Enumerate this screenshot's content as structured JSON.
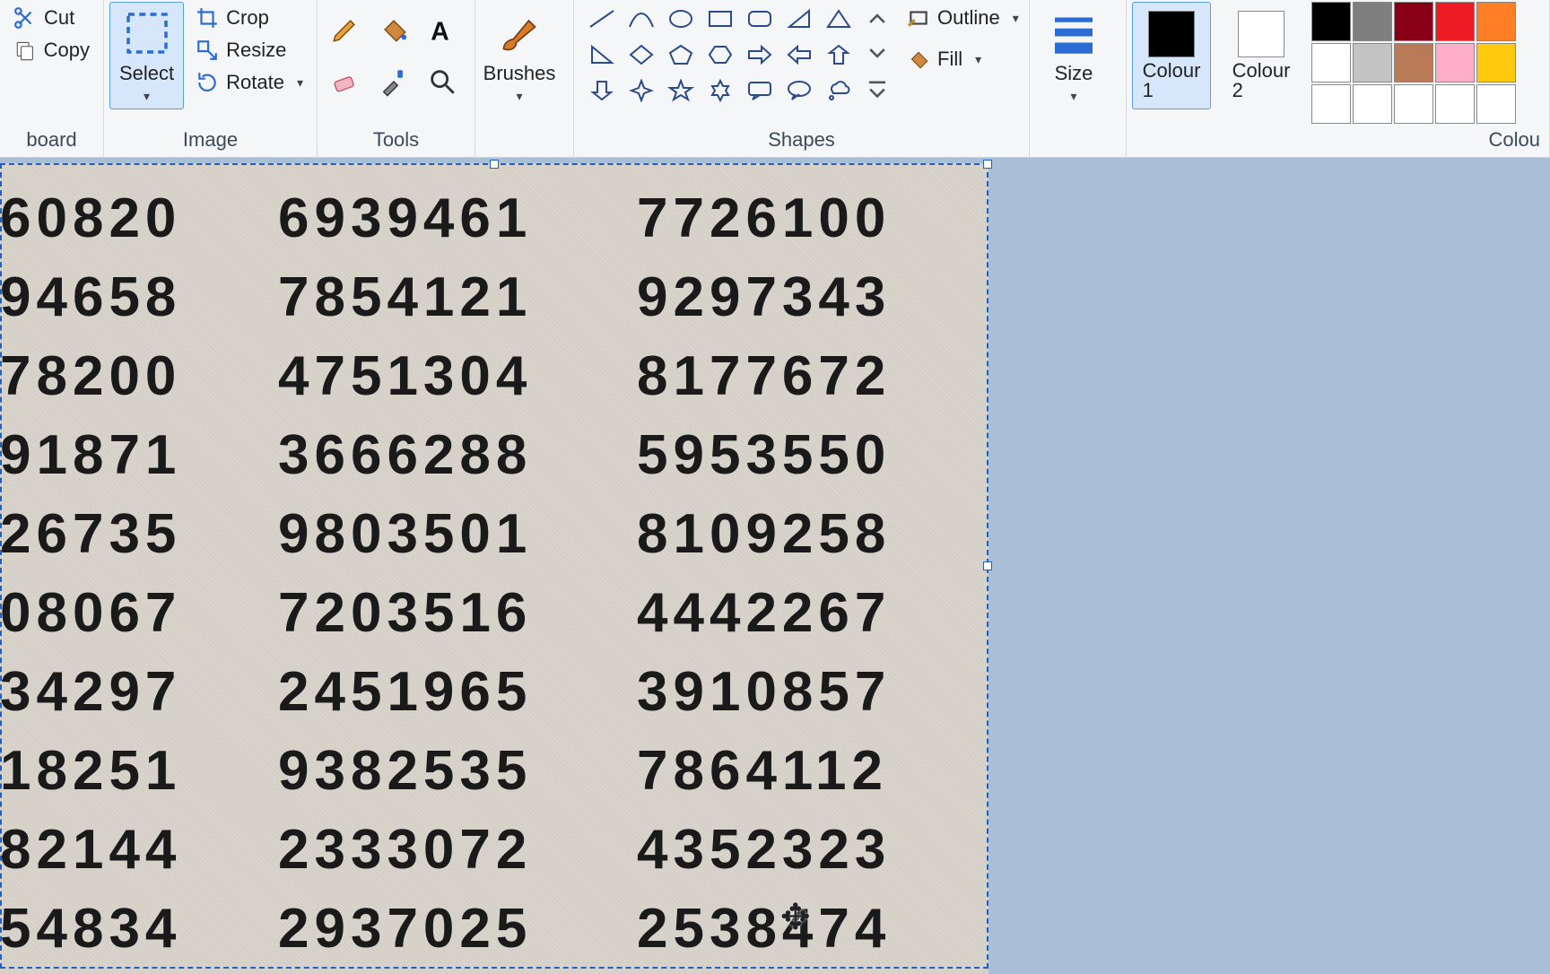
{
  "ribbon": {
    "clipboard": {
      "label": "board",
      "cut": "Cut",
      "copy": "Copy"
    },
    "image": {
      "label": "Image",
      "select": "Select",
      "crop": "Crop",
      "resize": "Resize",
      "rotate": "Rotate"
    },
    "tools": {
      "label": "Tools"
    },
    "brushes": {
      "label": "Brushes"
    },
    "shapes": {
      "label": "Shapes",
      "outline": "Outline",
      "fill": "Fill"
    },
    "size": {
      "label": "Size"
    },
    "colour1": {
      "label1": "Colour",
      "label2": "1"
    },
    "colour2": {
      "label1": "Colour",
      "label2": "2"
    },
    "colours": {
      "label": "Colou"
    }
  },
  "colours": {
    "c1": "#000000",
    "c2": "#ffffff",
    "palette": [
      "#000000",
      "#7f7f7f",
      "#880015",
      "#ed1c24",
      "#ff7f27",
      "#ffffff",
      "#c3c3c3",
      "#b97a57",
      "#ffaec9",
      "#ffc90e",
      "#ffffff",
      "#ffffff",
      "#ffffff",
      "#ffffff",
      "#ffffff"
    ]
  },
  "canvas": {
    "rows": [
      {
        "c1": "60820",
        "c2": "6939461",
        "c3": "7726100"
      },
      {
        "c1": "94658",
        "c2": "7854121",
        "c3": "9297343"
      },
      {
        "c1": "78200",
        "c2": "4751304",
        "c3": "8177672"
      },
      {
        "c1": "91871",
        "c2": "3666288",
        "c3": "5953550"
      },
      {
        "c1": "26735",
        "c2": "9803501",
        "c3": "8109258"
      },
      {
        "c1": "08067",
        "c2": "7203516",
        "c3": "4442267"
      },
      {
        "c1": "34297",
        "c2": "2451965",
        "c3": "3910857"
      },
      {
        "c1": "18251",
        "c2": "9382535",
        "c3": "7864112"
      },
      {
        "c1": "82144",
        "c2": "2333072",
        "c3": "4352323"
      },
      {
        "c1": "54834",
        "c2": "2937025",
        "c3": "2538474"
      }
    ],
    "cursor_overlay_row_index": 9
  }
}
